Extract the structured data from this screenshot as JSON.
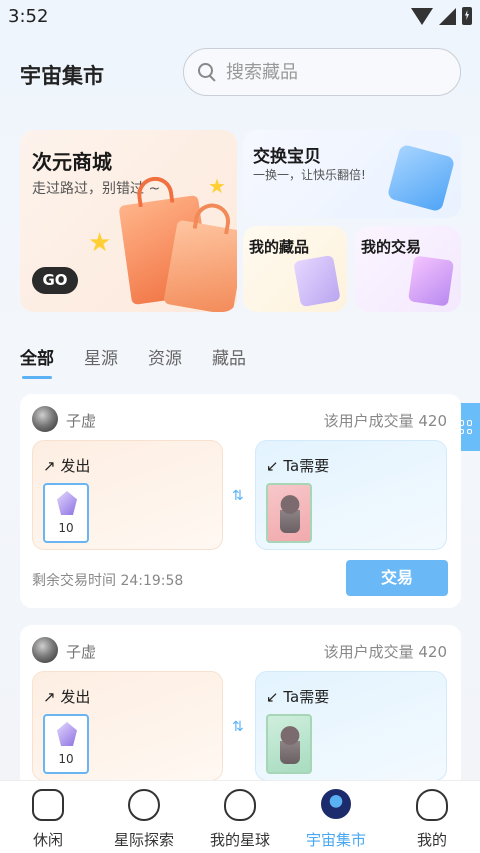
{
  "status_bar": {
    "time": "3:52"
  },
  "header": {
    "title": "宇宙集市"
  },
  "search": {
    "placeholder": "搜索藏品"
  },
  "banners": {
    "mall": {
      "title": "次元商城",
      "subtitle": "走过路过，别错过 ~",
      "button": "GO"
    },
    "exchange": {
      "title": "交换宝贝",
      "subtitle": "一换一，让快乐翻倍!"
    },
    "collection": {
      "title": "我的藏品"
    },
    "trades": {
      "title": "我的交易"
    }
  },
  "tabs": [
    {
      "label": "全部",
      "active": true
    },
    {
      "label": "星源",
      "active": false
    },
    {
      "label": "资源",
      "active": false
    },
    {
      "label": "藏品",
      "active": false
    }
  ],
  "trade_cards": [
    {
      "username": "子虚",
      "volume": "该用户成交量 420",
      "give_title": "↗ 发出",
      "give_count": "10",
      "need_title": "↙ Ta需要",
      "timer": "剩余交易时间 24:19:58",
      "button": "交易"
    },
    {
      "username": "子虚",
      "volume": "该用户成交量 420",
      "give_title": "↗ 发出",
      "give_count": "10",
      "need_title": "↙ Ta需要"
    }
  ],
  "bottom_nav": [
    {
      "label": "休闲",
      "icon": "tv-icon",
      "active": false
    },
    {
      "label": "星际探索",
      "icon": "astronaut-icon",
      "active": false
    },
    {
      "label": "我的星球",
      "icon": "cat-planet-icon",
      "active": false
    },
    {
      "label": "宇宙集市",
      "icon": "ufo-icon",
      "active": true
    },
    {
      "label": "我的",
      "icon": "bear-icon",
      "active": false
    }
  ],
  "colors": {
    "accent": "#5ab2f5",
    "button": "#6ab8f6",
    "text": "#222222"
  }
}
